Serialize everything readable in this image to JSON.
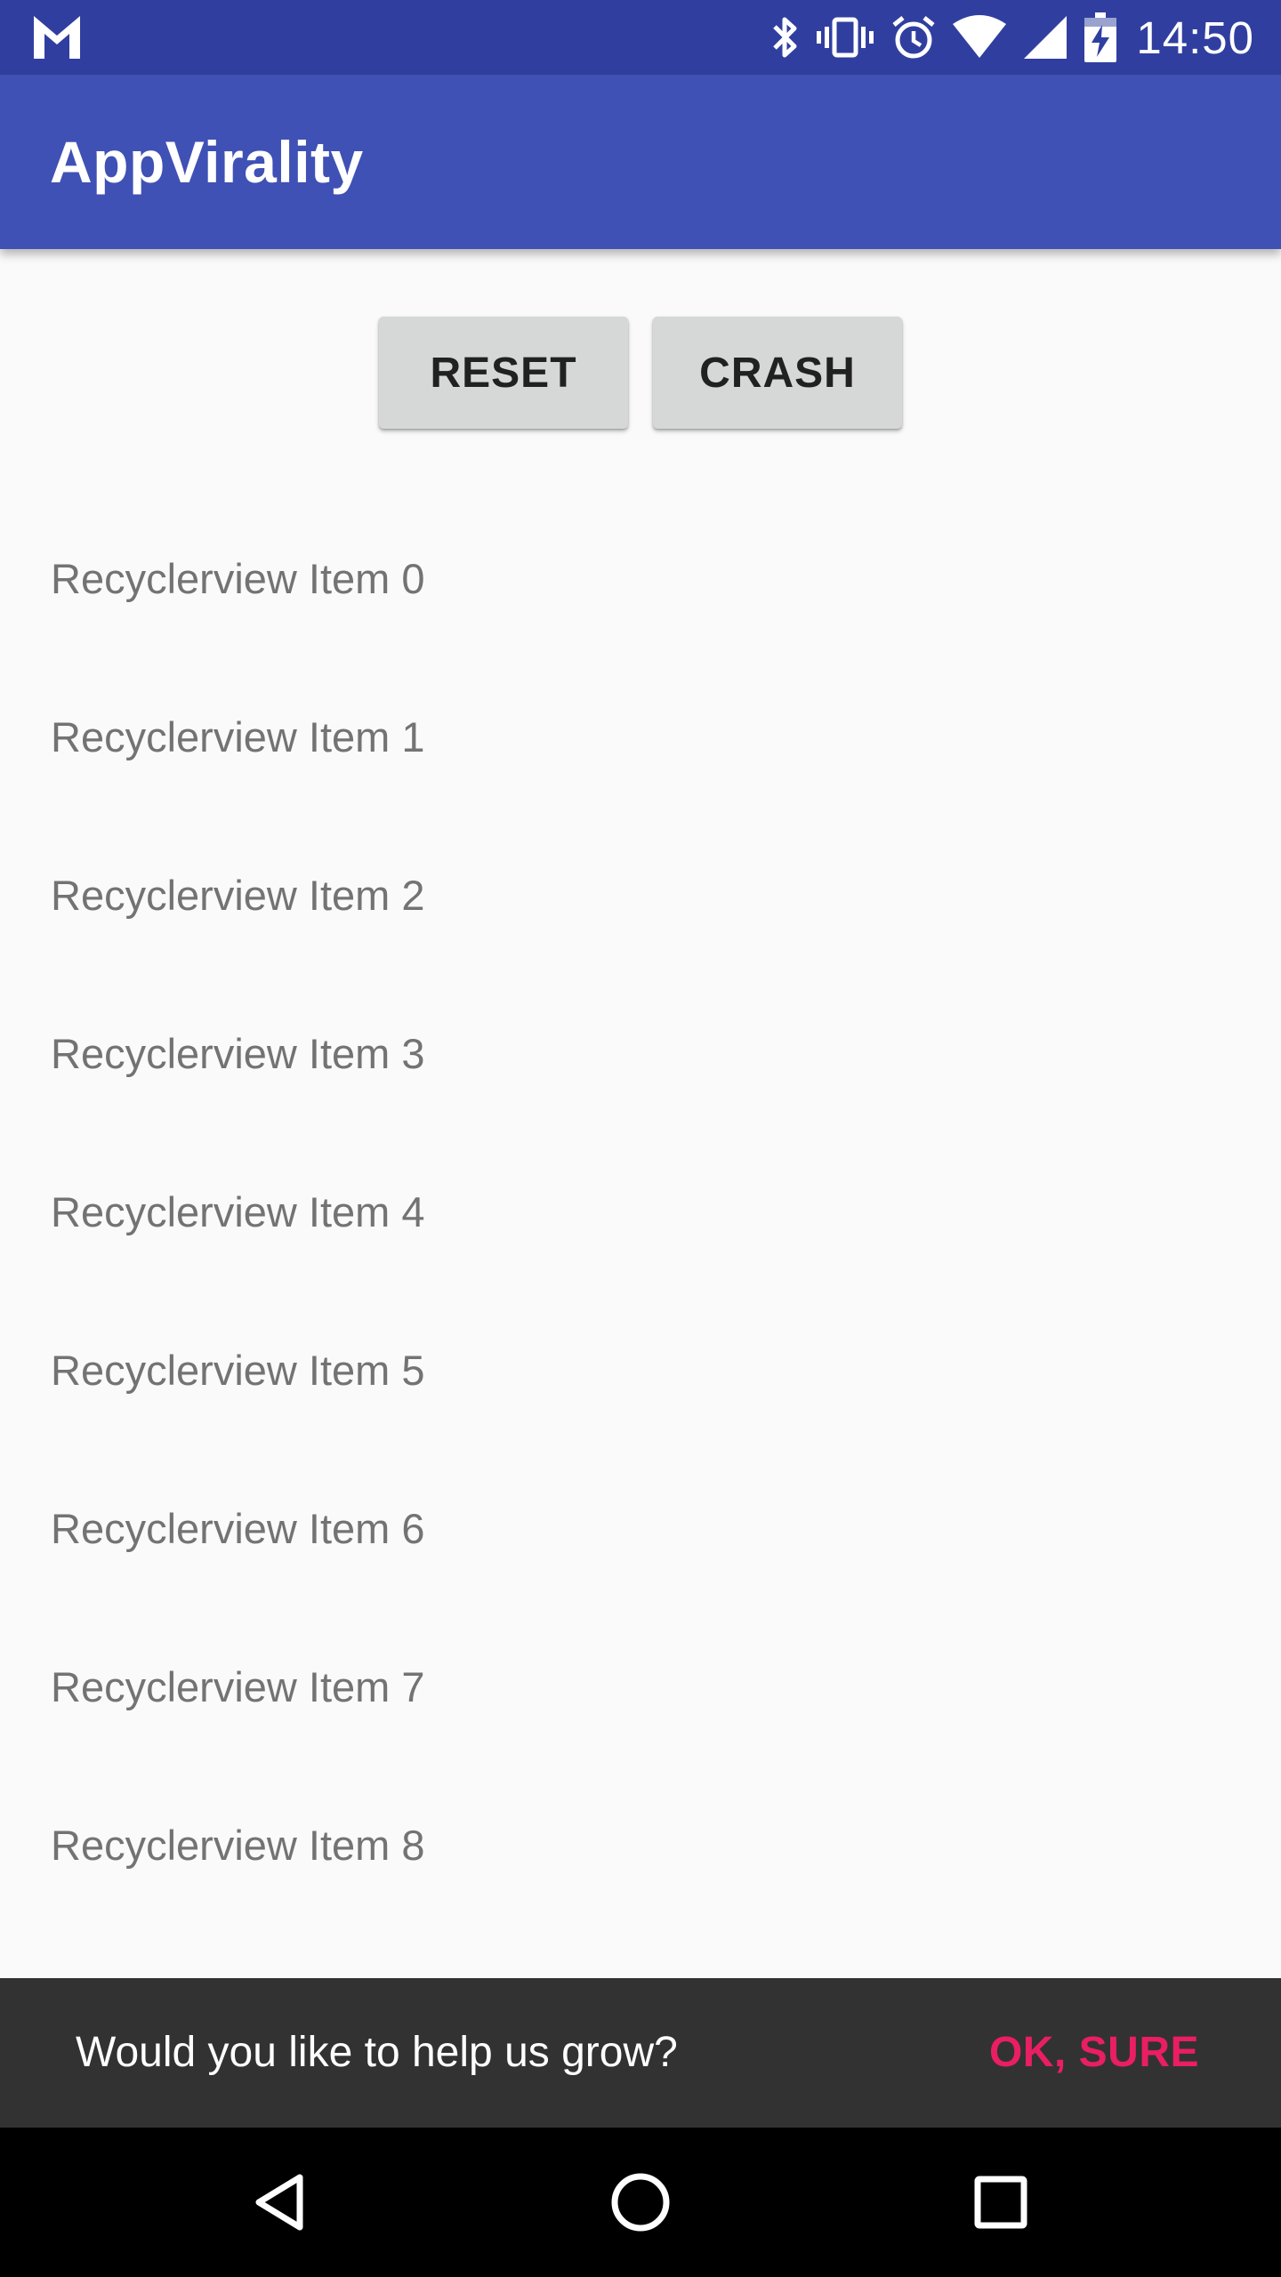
{
  "status_bar": {
    "time": "14:50",
    "icons": [
      "gmail-icon",
      "bluetooth-icon",
      "vibrate-icon",
      "alarm-icon",
      "wifi-icon",
      "signal-icon",
      "battery-charging-icon"
    ]
  },
  "toolbar": {
    "title": "AppVirality"
  },
  "actions": {
    "reset_label": "RESET",
    "crash_label": "CRASH"
  },
  "list": {
    "items": [
      "Recyclerview Item 0",
      "Recyclerview Item 1",
      "Recyclerview Item 2",
      "Recyclerview Item 3",
      "Recyclerview Item 4",
      "Recyclerview Item 5",
      "Recyclerview Item 6",
      "Recyclerview Item 7",
      "Recyclerview Item 8"
    ]
  },
  "snackbar": {
    "message": "Would you like to help us grow?",
    "action_label": "OK, SURE"
  },
  "nav_bar": {
    "buttons": [
      "back-icon",
      "home-icon",
      "recents-icon"
    ]
  },
  "colors": {
    "status_bar": "#303F9F",
    "toolbar": "#3F51B5",
    "background": "#FAFAFA",
    "button": "#D6D7D7",
    "snackbar": "#323232",
    "accent": "#E91E63"
  }
}
